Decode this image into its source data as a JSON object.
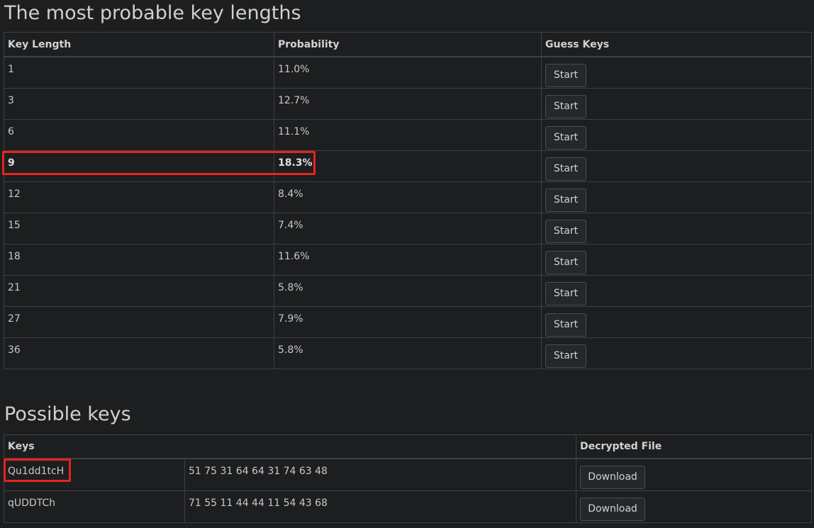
{
  "section1": {
    "title": "The most probable key lengths",
    "headers": [
      "Key Length",
      "Probability",
      "Guess Keys"
    ],
    "rows": [
      {
        "length": "1",
        "probability": "11.0%",
        "button": "Start"
      },
      {
        "length": "3",
        "probability": "12.7%",
        "button": "Start"
      },
      {
        "length": "6",
        "probability": "11.1%",
        "button": "Start"
      },
      {
        "length": "9",
        "probability": "18.3%",
        "button": "Start"
      },
      {
        "length": "12",
        "probability": "8.4%",
        "button": "Start"
      },
      {
        "length": "15",
        "probability": "7.4%",
        "button": "Start"
      },
      {
        "length": "18",
        "probability": "11.6%",
        "button": "Start"
      },
      {
        "length": "21",
        "probability": "5.8%",
        "button": "Start"
      },
      {
        "length": "27",
        "probability": "7.9%",
        "button": "Start"
      },
      {
        "length": "36",
        "probability": "5.8%",
        "button": "Start"
      }
    ]
  },
  "section2": {
    "title": "Possible keys",
    "headers": [
      "Keys",
      "Decrypted File"
    ],
    "rows": [
      {
        "key": "Qu1dd1tcH",
        "hex": "51 75 31 64 64 31 74 63 48",
        "button": "Download"
      },
      {
        "key": "qUDDTCh",
        "hex": "71 55 11 44 44 11 54 43 68",
        "button": "Download"
      }
    ]
  },
  "highlight_color": "#e8231a"
}
